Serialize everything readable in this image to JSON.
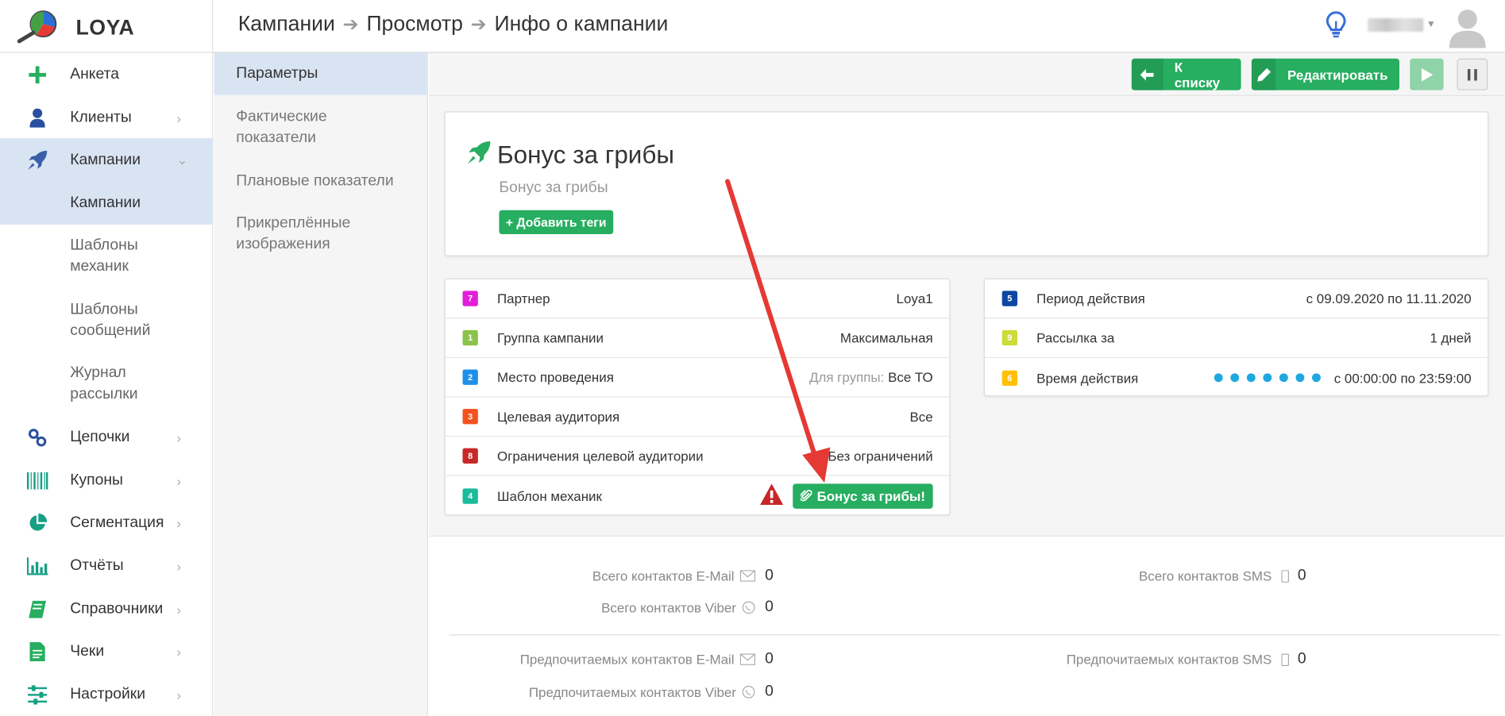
{
  "app": {
    "name": "LOYA"
  },
  "header": {
    "breadcrumbs": [
      "Кампании",
      "Просмотр",
      "Инфо о кампании"
    ],
    "icons": {
      "hint": "lightbulb-icon",
      "user": "user-avatar-icon"
    }
  },
  "sidebar": {
    "items": [
      {
        "label": "Анкета",
        "icon": "plus-icon"
      },
      {
        "label": "Клиенты",
        "icon": "user-icon",
        "chevron": "›"
      },
      {
        "label": "Кампании",
        "icon": "rocket-icon",
        "chevron": "⌄"
      },
      {
        "label": "Цепочки",
        "icon": "chain-icon",
        "chevron": "›"
      },
      {
        "label": "Купоны",
        "icon": "barcode-icon",
        "chevron": "›"
      },
      {
        "label": "Сегментация",
        "icon": "pie-chart-icon",
        "chevron": "›"
      },
      {
        "label": "Отчёты",
        "icon": "bar-chart-icon",
        "chevron": "›"
      },
      {
        "label": "Справочники",
        "icon": "book-icon",
        "chevron": "›"
      },
      {
        "label": "Чеки",
        "icon": "receipt-icon",
        "chevron": "›"
      },
      {
        "label": "Настройки",
        "icon": "sliders-icon",
        "chevron": "›"
      }
    ],
    "sub_items": [
      "Кампании",
      "Шаблоны механик",
      "Шаблоны сообщений",
      "Журнал рассылки"
    ]
  },
  "subnav": {
    "items": [
      "Параметры",
      "Фактические показатели",
      "Плановые показатели",
      "Прикреплённые изображения"
    ]
  },
  "toolbar": {
    "back_label": "К списку",
    "edit_label": "Редактировать"
  },
  "campaign": {
    "title": "Бонус за грибы",
    "subtitle": "Бонус за грибы",
    "add_tags_label": "+ Добавить теги"
  },
  "params_left": [
    {
      "num": "7",
      "color": "#e31ed8",
      "label": "Партнер",
      "value": "Loya1"
    },
    {
      "num": "1",
      "color": "#8bc34a",
      "label": "Группа кампании",
      "value": "Максимальная"
    },
    {
      "num": "2",
      "color": "#1e90e8",
      "label": "Место проведения",
      "prefix": "Для группы:",
      "value": "Все ТО"
    },
    {
      "num": "3",
      "color": "#f4511e",
      "label": "Целевая аудитория",
      "value": "Все"
    },
    {
      "num": "8",
      "color": "#c62828",
      "label": "Ограничения целевой аудитории",
      "value": "Без ограничений"
    },
    {
      "num": "4",
      "color": "#1abc9c",
      "label": "Шаблон механик",
      "value": "Бонус за грибы!"
    }
  ],
  "params_right": [
    {
      "num": "5",
      "color": "#0d47a1",
      "label": "Период действия",
      "value": "с 09.09.2020 по 11.11.2020"
    },
    {
      "num": "9",
      "color": "#cddc39",
      "label": "Рассылка за",
      "value": "1 дней"
    },
    {
      "num": "6",
      "color": "#ffc107",
      "label": "Время действия",
      "value": "с 00:00:00 по 23:59:00",
      "dot_count": 7
    }
  ],
  "stats": {
    "email_total": {
      "label": "Всего контактов E-Mail",
      "value": "0"
    },
    "viber_total": {
      "label": "Всего контактов Viber",
      "value": "0"
    },
    "sms_total": {
      "label": "Всего контактов SMS",
      "value": "0"
    },
    "email_pref": {
      "label": "Предпочитаемых контактов E-Mail",
      "value": "0"
    },
    "viber_pref": {
      "label": "Предпочитаемых контактов Viber",
      "value": "0"
    },
    "sms_pref": {
      "label": "Предпочитаемых контактов SMS",
      "value": "0"
    }
  },
  "colors": {
    "green": "#27ae60",
    "active_bg": "#d9e4f3",
    "annotation_arrow": "#e53935"
  }
}
